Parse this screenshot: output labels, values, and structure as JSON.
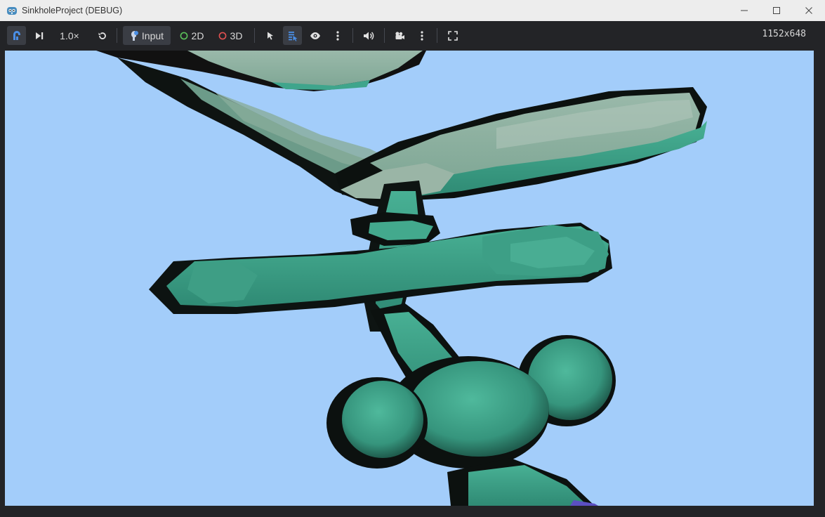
{
  "window": {
    "title": "SinkholeProject (DEBUG)"
  },
  "toolbar": {
    "speed_label": "1.0×",
    "input_label": "Input",
    "mode_2d_label": "2D",
    "mode_3d_label": "3D",
    "resolution_label": "1152x648"
  },
  "colors": {
    "sky": "#a3cdfa",
    "mesh_teal": "#3fa58c",
    "mesh_pale": "#8fb0a0",
    "accent_blue": "#4a8fe7",
    "toggle_2d": "#5ac05a",
    "toggle_3d": "#e05050"
  },
  "icons": [
    "godot-icon",
    "minimize-icon",
    "maximize-icon",
    "close-icon",
    "remote-debug-icon",
    "step-frame-icon",
    "reset-speed-icon",
    "input-icon",
    "select-icon",
    "list-select-icon",
    "eye-icon",
    "kebab-menu-icon",
    "speaker-icon",
    "camera-icon",
    "fullscreen-icon"
  ]
}
